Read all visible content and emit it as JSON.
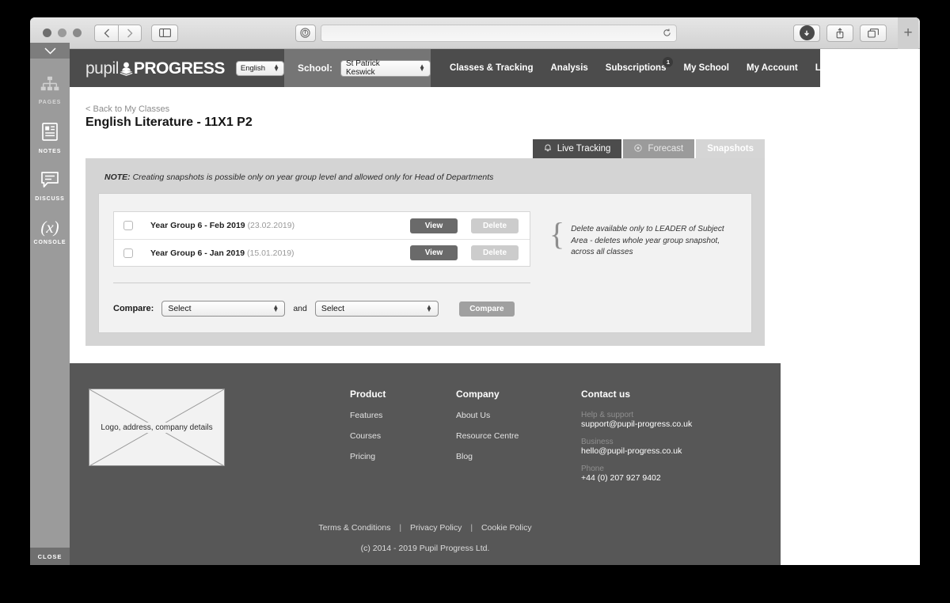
{
  "browser": {
    "back_icon": "chevron-left-icon",
    "forward_icon": "chevron-right-icon",
    "sidebar_icon": "sidebar-toggle-icon",
    "shield_icon": "shield-icon",
    "url_value": "",
    "url_placeholder": "",
    "reload_icon": "reload-icon",
    "download_icon": "download-icon",
    "share_icon": "share-icon",
    "tabs_icon": "tabs-icon",
    "new_tab_label": "+"
  },
  "dev_sidebar": {
    "collapse_icon": "chevron-down-icon",
    "items": [
      {
        "label": "PAGES",
        "icon": "sitemap-icon"
      },
      {
        "label": "NOTES",
        "icon": "document-icon"
      },
      {
        "label": "DISCUSS",
        "icon": "speech-bubble-icon"
      },
      {
        "label": "CONSOLE",
        "icon": "function-x-icon",
        "glyph": "(x)"
      }
    ],
    "close_label": "CLOSE"
  },
  "header": {
    "logo_light": "pupil",
    "logo_bold": "PROGRESS",
    "logo_icon": "pupil-book-icon",
    "language_value": "English",
    "school_label": "School:",
    "school_value": "St Patrick Keswick",
    "nav": [
      {
        "label": "Classes & Tracking",
        "badge": null
      },
      {
        "label": "Analysis",
        "badge": null
      },
      {
        "label": "Subscriptions",
        "badge": "1"
      },
      {
        "label": "My School",
        "badge": null
      },
      {
        "label": "My Account",
        "badge": null
      },
      {
        "label": "Logout",
        "badge": null
      }
    ]
  },
  "page": {
    "back_link": "< Back to My Classes",
    "title": "English Literature - 11X1 P2"
  },
  "tabs": [
    {
      "label": "Live Tracking",
      "icon": "bell-icon",
      "state": "inactive-dark"
    },
    {
      "label": "Forecast",
      "icon": "target-icon",
      "state": "inactive-mid"
    },
    {
      "label": "Snapshots",
      "icon": null,
      "state": "active"
    }
  ],
  "panel": {
    "note_prefix": "NOTE:",
    "note_text": " Creating snapshots is possible only on year group level and allowed only for Head of Departments",
    "snapshots": [
      {
        "name": "Year Group 6 - Feb 2019",
        "date": "(23.02.2019)",
        "checked": false,
        "view_label": "View",
        "delete_label": "Delete"
      },
      {
        "name": "Year Group 6 - Jan 2019",
        "date": "(15.01.2019)",
        "checked": false,
        "view_label": "View",
        "delete_label": "Delete"
      }
    ],
    "annotation": "Delete available only to LEADER of Subject Area  -  deletes whole year group snapshot, across all classes",
    "compare_label": "Compare:",
    "compare_select_1": "Select",
    "compare_and": "and",
    "compare_select_2": "Select",
    "compare_button": "Compare"
  },
  "footer": {
    "logo_placeholder": "Logo, address, company details",
    "columns": [
      {
        "heading": "Product",
        "links": [
          "Features",
          "Courses",
          "Pricing"
        ]
      },
      {
        "heading": "Company",
        "links": [
          "About Us",
          "Resource Centre",
          "Blog"
        ]
      }
    ],
    "contact": {
      "heading": "Contact us",
      "groups": [
        {
          "label": "Help & support",
          "value": "support@pupil-progress.co.uk"
        },
        {
          "label": "Business",
          "value": "hello@pupil-progress.co.uk"
        },
        {
          "label": "Phone",
          "value": "+44 (0) 207 927 9402"
        }
      ]
    },
    "legal": [
      "Terms & Conditions",
      "Privacy Policy",
      "Cookie Policy"
    ],
    "separator": "|",
    "copyright": "(c) 2014 - 2019 Pupil Progress Ltd."
  },
  "colors": {
    "header_dark": "#4c4c4c",
    "header_mid": "#757575",
    "panel_gray": "#d4d4d4",
    "footer_gray": "#575757",
    "button_view": "#6a6a6a",
    "button_delete": "#cccccc"
  }
}
